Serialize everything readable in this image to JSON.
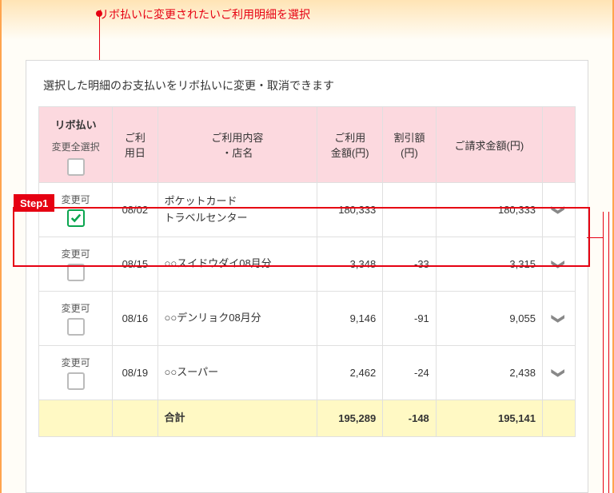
{
  "annotation": {
    "text": "リボ払いに変更されたいご利用明細を選択",
    "step_label": "Step1"
  },
  "panel": {
    "title": "選択した明細のお支払いをリボ払いに変更・取消できます"
  },
  "table": {
    "headers": {
      "revolving_title": "リボ払い",
      "select_all_label": "変更全選択",
      "date": "ご利\n用日",
      "description": "ご利用内容\n・店名",
      "amount": "ご利用\n金額(円)",
      "discount": "割引額\n(円)",
      "billed": "ご請求金額(円)"
    },
    "change_label": "変更可",
    "rows": [
      {
        "checked": true,
        "date": "08/02",
        "description": "ポケットカード\nトラベルセンター",
        "amount": "180,333",
        "discount": "",
        "billed": "180,333"
      },
      {
        "checked": false,
        "date": "08/15",
        "description": "○○スイドウダイ08月分",
        "amount": "3,348",
        "discount": "-33",
        "billed": "3,315"
      },
      {
        "checked": false,
        "date": "08/16",
        "description": "○○デンリョク08月分",
        "amount": "9,146",
        "discount": "-91",
        "billed": "9,055"
      },
      {
        "checked": false,
        "date": "08/19",
        "description": "○○スーパー",
        "amount": "2,462",
        "discount": "-24",
        "billed": "2,438"
      }
    ],
    "total": {
      "label": "合計",
      "amount": "195,289",
      "discount": "-148",
      "billed": "195,141"
    }
  }
}
